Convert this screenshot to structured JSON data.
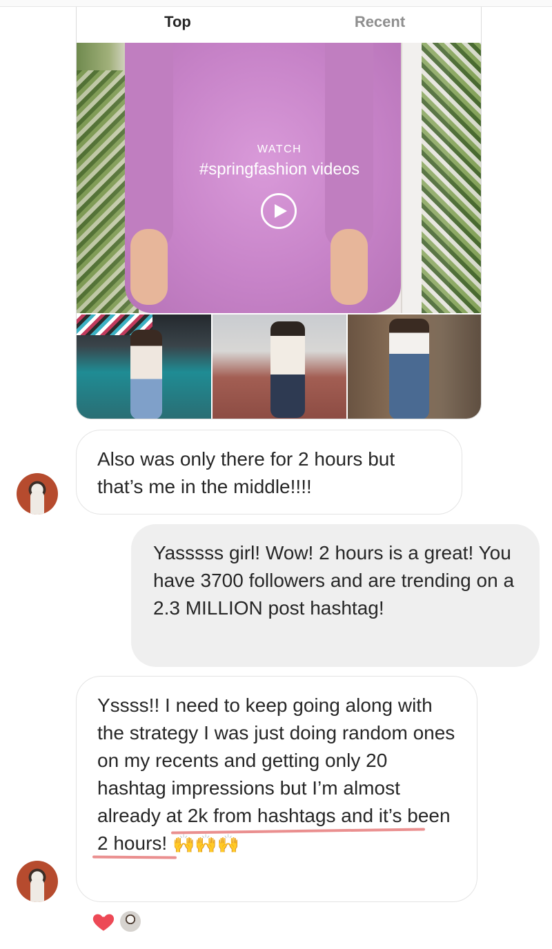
{
  "tabs": {
    "top": "Top",
    "recent": "Recent"
  },
  "shared_post": {
    "watch_label": "WATCH",
    "watch_title": "#springfashion videos"
  },
  "messages": [
    {
      "from": "them",
      "text": "Also was only there for 2 hours but that’s me in the middle!!!!"
    },
    {
      "from": "me",
      "text": "Yasssss girl! Wow! 2 hours is a great! You have 3700 followers and are trending on a 2.3 MILLION post hashtag!"
    },
    {
      "from": "them",
      "text_before": "Yssss!! I need to keep going along with the strategy I was just doing random ones on my recents and getting only 20 hashtag impressions but I’m almost already at 2k from hashtags and it’s been 2 hours!",
      "emoji": "🙌🙌🙌"
    }
  ],
  "colors": {
    "heart": "#ed4956",
    "sent_bubble": "#efefef",
    "border": "#dbdbdb"
  },
  "icons": {
    "play": "play-icon",
    "heart": "heart-icon"
  }
}
